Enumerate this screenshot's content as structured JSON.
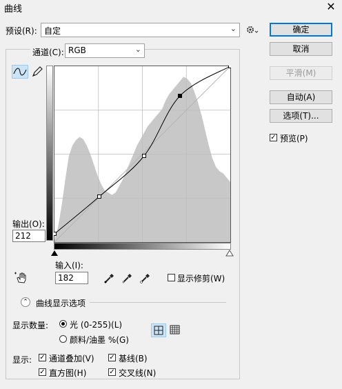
{
  "window": {
    "title": "曲线"
  },
  "preset": {
    "label": "预设(R):",
    "value": "自定"
  },
  "channel": {
    "label": "通道(C):",
    "value": "RGB"
  },
  "buttons": {
    "ok": "确定",
    "cancel": "取消",
    "smooth": "平滑(M)",
    "auto": "自动(A)",
    "options": "选项(T)..."
  },
  "preview": {
    "label": "预览(P)",
    "checked": true
  },
  "output": {
    "label": "输出(O):",
    "value": "212"
  },
  "input": {
    "label": "输入(I):",
    "value": "182"
  },
  "show_clipping": {
    "label": "显示修剪(W)",
    "checked": false
  },
  "display_options": {
    "title": "曲线显示选项"
  },
  "show_amount": {
    "label": "显示数量:",
    "options": [
      {
        "label": "光 (0-255)(L)",
        "selected": true
      },
      {
        "label": "颜料/油墨 %(G)",
        "selected": false
      }
    ]
  },
  "show": {
    "label": "显示:",
    "items": [
      {
        "label": "通道叠加(V)",
        "checked": true
      },
      {
        "label": "基线(B)",
        "checked": true
      },
      {
        "label": "直方图(H)",
        "checked": true
      },
      {
        "label": "交叉线(N)",
        "checked": true
      }
    ]
  },
  "curve": {
    "points": [
      [
        0,
        12
      ],
      [
        65,
        66
      ],
      [
        130,
        125
      ],
      [
        182,
        212
      ],
      [
        255,
        255
      ]
    ],
    "selected_index": 3,
    "range": [
      0,
      255
    ]
  },
  "histogram": {
    "values": [
      2,
      14,
      34,
      58,
      80,
      90,
      95,
      98,
      96,
      90,
      82,
      72,
      62,
      54,
      48,
      46,
      44,
      46,
      52,
      58,
      66,
      74,
      82,
      90,
      96,
      102,
      108,
      112,
      116,
      120,
      124,
      132,
      138,
      142,
      146,
      150,
      154,
      152,
      148,
      140,
      130,
      118,
      104,
      90,
      78,
      70,
      66,
      64,
      60,
      56
    ]
  },
  "icons": {
    "curve_tool": "curve-tool-icon",
    "pencil_tool": "pencil-tool-icon",
    "settings": "gear-icon",
    "hand": "hand-adjust-icon",
    "eyedroppers": [
      "black-eyedropper-icon",
      "gray-eyedropper-icon",
      "white-eyedropper-icon"
    ]
  }
}
